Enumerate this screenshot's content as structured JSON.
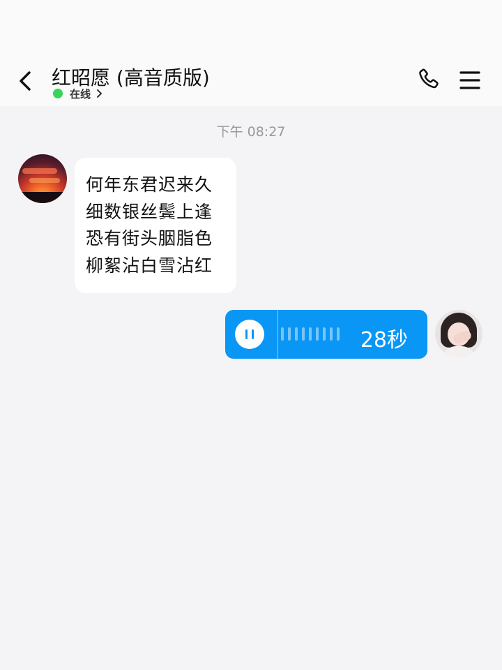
{
  "header": {
    "title": "红昭愿 (高音质版)",
    "status": "在线",
    "status_color": "#39d45a",
    "icons": [
      "back-arrow-icon",
      "phone-icon",
      "menu-icon",
      "chevron-right-icon"
    ]
  },
  "chat": {
    "timestamp": "下午 08:27",
    "messages": [
      {
        "side": "left",
        "type": "text",
        "lines": [
          "何年东君迟来久",
          "细数银丝鬓上逢",
          "恐有街头胭脂色",
          "柳絮沾白雪沾红"
        ]
      },
      {
        "side": "right",
        "type": "voice",
        "duration": "28秒",
        "state": "playing",
        "bubble_color": "#0a96f5"
      }
    ]
  }
}
